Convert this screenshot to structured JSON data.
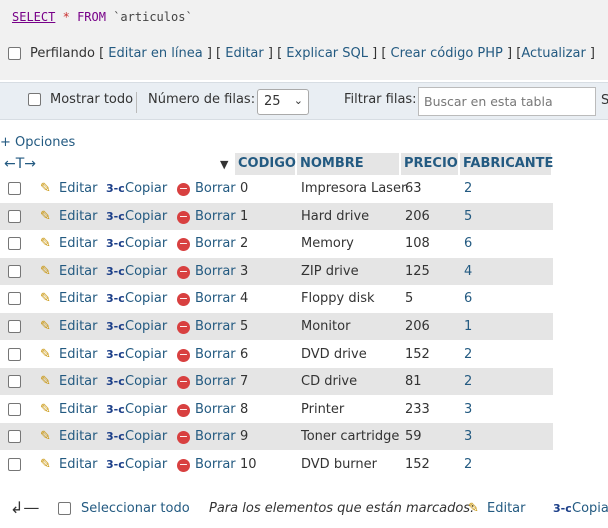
{
  "sql": {
    "select_kw": "SELECT",
    "star": "*",
    "from_kw": "FROM",
    "table": "`articulos`"
  },
  "profiling": {
    "label": "Perfilando",
    "links": [
      "Editar en línea",
      "Editar",
      "Explicar SQL",
      "Crear código PHP",
      "Actualizar"
    ]
  },
  "toolbar": {
    "show_all": "Mostrar todo",
    "rows_label": "Número de filas:",
    "rows_value": "25",
    "filter_label": "Filtrar filas:",
    "search_placeholder": "Buscar en esta tabla",
    "cut_text": "S"
  },
  "options_link": "+ Opciones",
  "columns": [
    "CODIGO",
    "NOMBRE",
    "PRECIO",
    "FABRICANTE"
  ],
  "actions": {
    "edit": "Editar",
    "copy": "Copiar",
    "delete": "Borrar"
  },
  "rows": [
    {
      "codigo": "0",
      "nombre": "Impresora Laser",
      "precio": "63",
      "fabricante": "2"
    },
    {
      "codigo": "1",
      "nombre": "Hard drive",
      "precio": "206",
      "fabricante": "5"
    },
    {
      "codigo": "2",
      "nombre": "Memory",
      "precio": "108",
      "fabricante": "6"
    },
    {
      "codigo": "3",
      "nombre": "ZIP drive",
      "precio": "125",
      "fabricante": "4"
    },
    {
      "codigo": "4",
      "nombre": "Floppy disk",
      "precio": "5",
      "fabricante": "6"
    },
    {
      "codigo": "5",
      "nombre": "Monitor",
      "precio": "206",
      "fabricante": "1"
    },
    {
      "codigo": "6",
      "nombre": "DVD drive",
      "precio": "152",
      "fabricante": "2"
    },
    {
      "codigo": "7",
      "nombre": "CD drive",
      "precio": "81",
      "fabricante": "2"
    },
    {
      "codigo": "8",
      "nombre": "Printer",
      "precio": "233",
      "fabricante": "3"
    },
    {
      "codigo": "9",
      "nombre": "Toner cartridge",
      "precio": "59",
      "fabricante": "3"
    },
    {
      "codigo": "10",
      "nombre": "DVD burner",
      "precio": "152",
      "fabricante": "2"
    }
  ],
  "footer": {
    "select_all": "Seleccionar todo",
    "marked_label": "Para los elementos que están marcados:",
    "edit": "Editar",
    "copy": "Copiar"
  },
  "icons": {
    "edit": "pencil-icon",
    "copy": "copy-icon",
    "delete": "delete-icon",
    "return": "return-arrow-icon",
    "sort": "sort-triangle-icon"
  }
}
